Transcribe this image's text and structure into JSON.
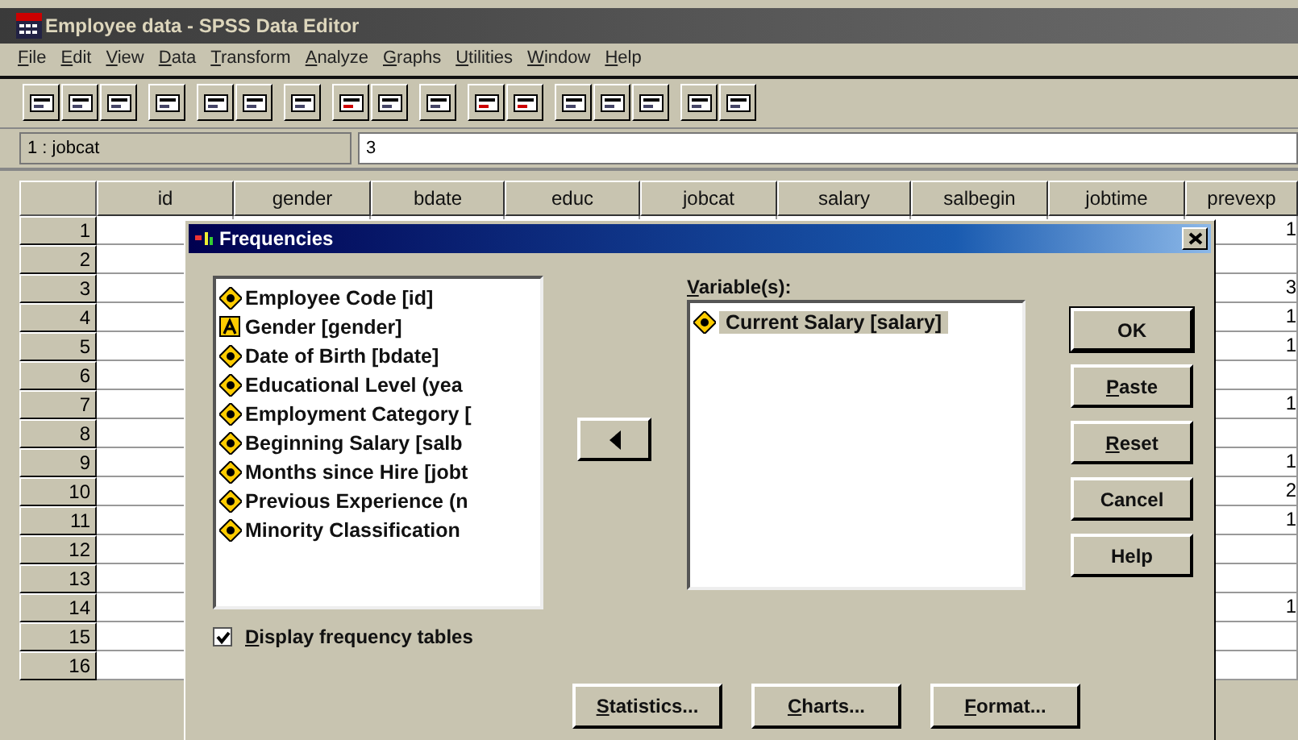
{
  "window": {
    "title": "Employee data - SPSS Data Editor"
  },
  "menu": [
    {
      "label": "File",
      "mnemonic": true
    },
    {
      "label": "Edit",
      "mnemonic": true
    },
    {
      "label": "View",
      "mnemonic": true
    },
    {
      "label": "Data",
      "mnemonic": true
    },
    {
      "label": "Transform",
      "mnemonic": true
    },
    {
      "label": "Analyze",
      "mnemonic": true
    },
    {
      "label": "Graphs",
      "mnemonic": true
    },
    {
      "label": "Utilities",
      "mnemonic": true
    },
    {
      "label": "Window",
      "mnemonic": true
    },
    {
      "label": "Help",
      "mnemonic": true
    }
  ],
  "cell_bar": {
    "cell": "1 : jobcat",
    "value": "3"
  },
  "grid": {
    "columns": [
      "id",
      "gender",
      "bdate",
      "educ",
      "jobcat",
      "salary",
      "salbegin",
      "jobtime",
      "prevexp"
    ],
    "rows": [
      {
        "number": "1",
        "prevexp": "1"
      },
      {
        "number": "2"
      },
      {
        "number": "3",
        "prevexp": "3"
      },
      {
        "number": "4",
        "prevexp": "1"
      },
      {
        "number": "5",
        "prevexp": "1"
      },
      {
        "number": "6"
      },
      {
        "number": "7",
        "prevexp": "1"
      },
      {
        "number": "8"
      },
      {
        "number": "9",
        "prevexp": "1"
      },
      {
        "number": "10",
        "prevexp": "2"
      },
      {
        "number": "11",
        "prevexp": "1"
      },
      {
        "number": "12"
      },
      {
        "number": "13"
      },
      {
        "number": "14",
        "prevexp": "1"
      },
      {
        "number": "15"
      },
      {
        "number": "16"
      }
    ]
  },
  "dialog": {
    "title": "Frequencies",
    "source_variables": [
      {
        "label": "Employee Code [id]",
        "kind": "scale"
      },
      {
        "label": "Gender [gender]",
        "kind": "string"
      },
      {
        "label": "Date of Birth [bdate]",
        "kind": "scale"
      },
      {
        "label": "Educational Level (yea",
        "kind": "scale"
      },
      {
        "label": "Employment Category [",
        "kind": "scale"
      },
      {
        "label": "Beginning Salary [salb",
        "kind": "scale"
      },
      {
        "label": "Months since Hire [jobt",
        "kind": "scale"
      },
      {
        "label": "Previous Experience (n",
        "kind": "scale"
      },
      {
        "label": "Minority Classification",
        "kind": "scale"
      }
    ],
    "target_label": {
      "label": "Variable(s):",
      "mnemonic": true
    },
    "target_variables": [
      {
        "label": "Current Salary [salary]",
        "kind": "scale",
        "selected": true
      }
    ],
    "side_buttons": [
      {
        "label": "OK",
        "mnemonic": false
      },
      {
        "label": "Paste",
        "mnemonic": true
      },
      {
        "label": "Reset",
        "mnemonic": true
      },
      {
        "label": "Cancel",
        "mnemonic": false
      },
      {
        "label": "Help",
        "mnemonic": false
      }
    ],
    "display_tables": {
      "label": "Display frequency tables",
      "mnemonic": true,
      "checked": true
    },
    "bottom_buttons": [
      {
        "label": "Statistics...",
        "mnemonic": true
      },
      {
        "label": "Charts...",
        "mnemonic": true
      },
      {
        "label": "Format...",
        "mnemonic": true
      }
    ]
  }
}
